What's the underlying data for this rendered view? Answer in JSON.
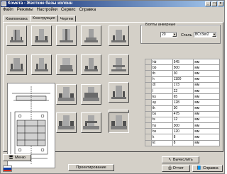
{
  "window": {
    "title": "Комета - Жесткие базы колонн",
    "minimize_label": "_",
    "maximize_label": "□",
    "close_label": "×"
  },
  "menu": [
    "Файл",
    "Режимы",
    "Настройки",
    "Сервис",
    "Справка"
  ],
  "tabs": [
    "Компоновка",
    "Конструкция",
    "Чертеж"
  ],
  "active_tab": "Конструкция",
  "bolts": {
    "group_label": "Болты анкерные",
    "diameter": "20",
    "steel_label": "Сталь",
    "steel": "ВСт3кп2"
  },
  "params": [
    {
      "sym": "hb",
      "value": "545",
      "unit": "мм"
    },
    {
      "sym": "bb",
      "value": "500",
      "unit": "мм"
    },
    {
      "sym": "tb",
      "value": "30",
      "unit": "мм"
    },
    {
      "sym": "h",
      "value": "1100",
      "unit": "мм"
    },
    {
      "sym": "dt",
      "value": "173",
      "unit": "мм"
    },
    {
      "sym": "l",
      "value": "22",
      "unit": "мм"
    },
    {
      "sym": "ks",
      "value": "65",
      "unit": "мм"
    },
    {
      "sym": "ay",
      "value": "128",
      "unit": "мм"
    },
    {
      "sym": "tk",
      "value": "30",
      "unit": "мм"
    },
    {
      "sym": "bs",
      "value": "475",
      "unit": "мм"
    },
    {
      "sym": "ts",
      "value": "12",
      "unit": "мм"
    },
    {
      "sym": "hs",
      "value": "300",
      "unit": "мм"
    },
    {
      "sym": "bs",
      "value": "120",
      "unit": "мм"
    },
    {
      "sym": "k",
      "value": "8",
      "unit": "мм"
    },
    {
      "sym": "kt",
      "value": "8",
      "unit": "мм"
    }
  ],
  "buttons": {
    "menu": "Меню",
    "design": "Проектирование",
    "calculate": "Вычислить",
    "report": "Отчет",
    "help": "Справка"
  },
  "colors": {
    "titlebar_start": "#0a246a",
    "titlebar_end": "#a6caf0",
    "face": "#d4d0c8",
    "flag_white": "#ffffff",
    "flag_blue": "#0039a6",
    "flag_red": "#d52b1e"
  },
  "icons": {
    "menu": "monitor-icon",
    "calculate": "cursor-icon",
    "report": "printer-icon",
    "help": "book-icon"
  }
}
